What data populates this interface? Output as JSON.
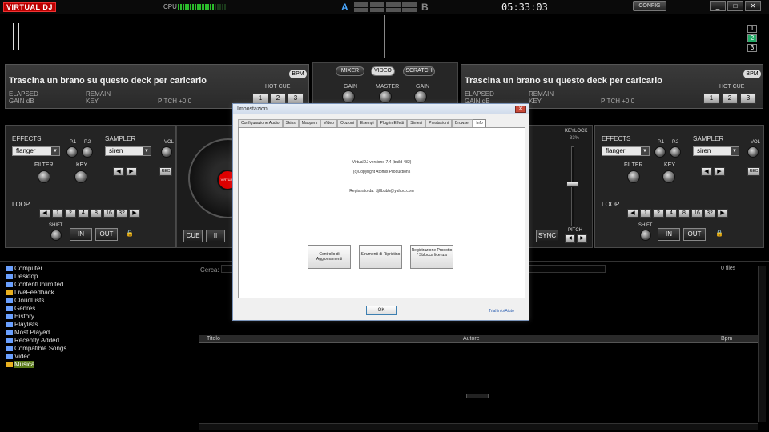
{
  "app": {
    "logo": "VIRTUAL DJ",
    "cpu_label": "CPU",
    "cpu_level_percent": 75,
    "crossfader_a": "A",
    "crossfader_b": "B",
    "clock": "05:33:03",
    "config_label": "CONFIG",
    "window_controls": [
      "_",
      "□",
      "✕"
    ]
  },
  "waveform": {
    "deck_numbers": [
      "1",
      "2",
      "3"
    ]
  },
  "deck_left": {
    "title": "Trascina un brano su questo deck per caricarlo",
    "elapsed": "ELAPSED",
    "gain_db": "GAIN dB",
    "remain": "REMAIN",
    "key": "KEY",
    "pitch": "PITCH +0.0",
    "bpm_label": "BPM",
    "hot_cue_label": "HOT CUE",
    "hot_cues": [
      "1",
      "2",
      "3"
    ],
    "effects_label": "EFFECTS",
    "effect_selected": "flanger",
    "p1": "P.1",
    "p2": "P.2",
    "filter": "FILTER",
    "key_knob": "KEY",
    "sampler_label": "SAMPLER",
    "sampler_selected": "siren",
    "vol": "VOL",
    "rec": "REC",
    "loop_label": "LOOP",
    "loop_values": [
      "1",
      "2",
      "4",
      "8",
      "16",
      "32"
    ],
    "shift": "SHIFT",
    "in": "IN",
    "out": "OUT"
  },
  "deck_right": {
    "title": "Trascina un brano su questo deck per caricarlo",
    "elapsed": "ELAPSED",
    "gain_db": "GAIN dB",
    "remain": "REMAIN",
    "key": "KEY",
    "pitch": "PITCH +0.0",
    "bpm_label": "BPM",
    "hot_cue_label": "HOT CUE",
    "hot_cues": [
      "1",
      "2",
      "3"
    ],
    "keylock": "KEYLOCK",
    "keylock_pct": "33%",
    "pitch_label": "PITCH",
    "effects_label": "EFFECTS",
    "effect_selected": "flanger",
    "p1": "P.1",
    "p2": "P.2",
    "filter": "FILTER",
    "key_knob": "KEY",
    "sampler_label": "SAMPLER",
    "sampler_selected": "siren",
    "vol": "VOL",
    "rec": "REC",
    "loop_label": "LOOP",
    "loop_values": [
      "1",
      "2",
      "4",
      "8",
      "16",
      "32"
    ],
    "shift": "SHIFT",
    "in": "IN",
    "out": "OUT",
    "sync": "SYNC"
  },
  "mixer": {
    "tabs": [
      "MIXER",
      "VIDEO",
      "SCRATCH"
    ],
    "gain_left": "GAIN",
    "master": "MASTER",
    "gain_right": "GAIN"
  },
  "left_transport": {
    "cue": "CUE",
    "pause": "II",
    "platter_label": "VIRTUAL"
  },
  "browser": {
    "tree": [
      {
        "label": "Computer",
        "color": "#6aa0ff"
      },
      {
        "label": "Desktop",
        "color": "#6aa0ff"
      },
      {
        "label": "ContentUnlimited",
        "color": "#6aa0ff"
      },
      {
        "label": "LiveFeedback",
        "color": "#e8b020"
      },
      {
        "label": "CloudLists",
        "color": "#6aa0ff"
      },
      {
        "label": "Genres",
        "color": "#6aa0ff"
      },
      {
        "label": "History",
        "color": "#6aa0ff"
      },
      {
        "label": "Playlists",
        "color": "#6aa0ff"
      },
      {
        "label": "Most Played",
        "color": "#6aa0ff"
      },
      {
        "label": "Recently Added",
        "color": "#6aa0ff"
      },
      {
        "label": "Compatible Songs",
        "color": "#6aa0ff"
      },
      {
        "label": "Video",
        "color": "#6aa0ff"
      },
      {
        "label": "Musica",
        "color": "#e8b020",
        "selected": true
      }
    ],
    "search_label": "Cerca:",
    "files_count": "0 files",
    "columns": [
      "Titolo",
      "Autore",
      "Bpm"
    ]
  },
  "dialog": {
    "title": "Impostazioni",
    "close": "✕",
    "tabs": [
      "Configurazione Audio",
      "Skins",
      "Mappers",
      "Video",
      "Opzioni",
      "Esempi",
      "Plug-in Effetti",
      "Sintesi",
      "Prestazioni",
      "Browser",
      "Info"
    ],
    "active_tab": 10,
    "version_line": "VirtualDJ versione 7.4 (build 482)",
    "copyright_line": "(c)Copyright Atomix Productions",
    "registered_line": "Registrato da: djlilbubb@yahoo.com",
    "buttons": [
      "Controllo di Aggiornamenti",
      "Strumenti di Ripristino",
      "Registrazione Prodotto / Sblocca licenza"
    ],
    "link": "Trial info/Aiuto",
    "ok": "OK"
  }
}
